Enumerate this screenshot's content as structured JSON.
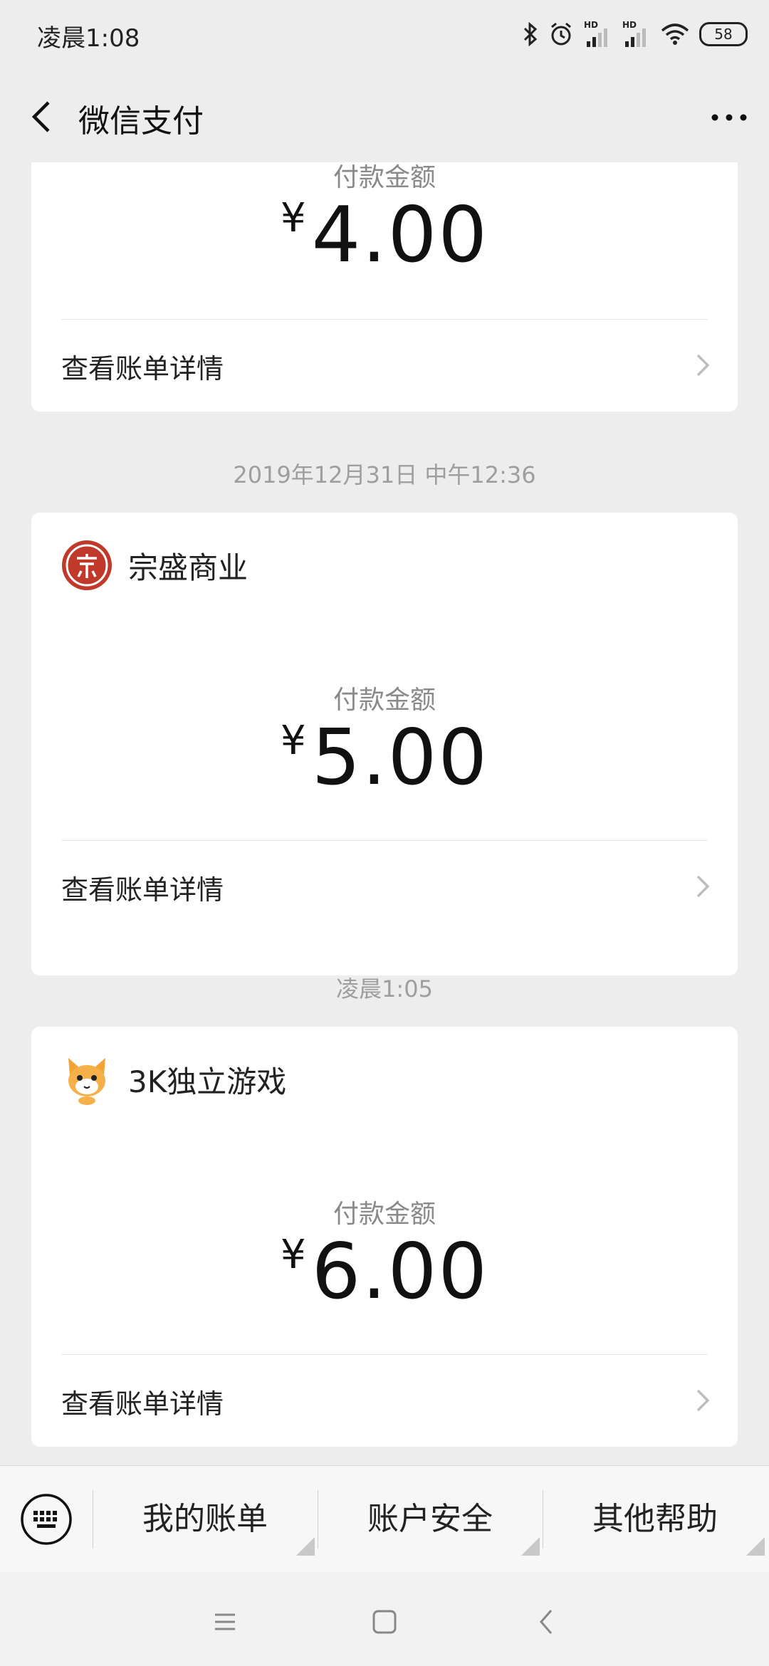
{
  "status_bar": {
    "time": "凌晨1:08",
    "battery": "58",
    "icons": [
      "bluetooth-icon",
      "alarm-icon",
      "signal-hd-icon",
      "signal-hd-icon",
      "wifi-icon",
      "battery-icon"
    ]
  },
  "header": {
    "title": "微信支付",
    "back_icon": "chevron-left-icon",
    "more_icon": "more-dots-icon"
  },
  "messages": [
    {
      "amount_label": "付款金额",
      "currency": "¥",
      "amount": "4.00",
      "detail_link": "查看账单详情"
    },
    {
      "timestamp": "2019年12月31日 中午12:36",
      "merchant": "宗盛商业",
      "amount_label": "付款金额",
      "currency": "¥",
      "amount": "5.00",
      "detail_link": "查看账单详情"
    },
    {
      "timestamp": "凌晨1:05",
      "merchant": "3K独立游戏",
      "amount_label": "付款金额",
      "currency": "¥",
      "amount": "6.00",
      "detail_link": "查看账单详情"
    }
  ],
  "menu": {
    "keyboard_icon": "keyboard-icon",
    "items": [
      {
        "label": "我的账单"
      },
      {
        "label": "账户安全"
      },
      {
        "label": "其他帮助"
      }
    ]
  },
  "nav": {
    "icons": [
      "menu-icon",
      "home-icon",
      "back-icon"
    ]
  },
  "colors": {
    "background": "#ededed",
    "card": "#ffffff",
    "merchant_logo_red": "#c0392b",
    "muted_text": "#8a8a8a"
  }
}
